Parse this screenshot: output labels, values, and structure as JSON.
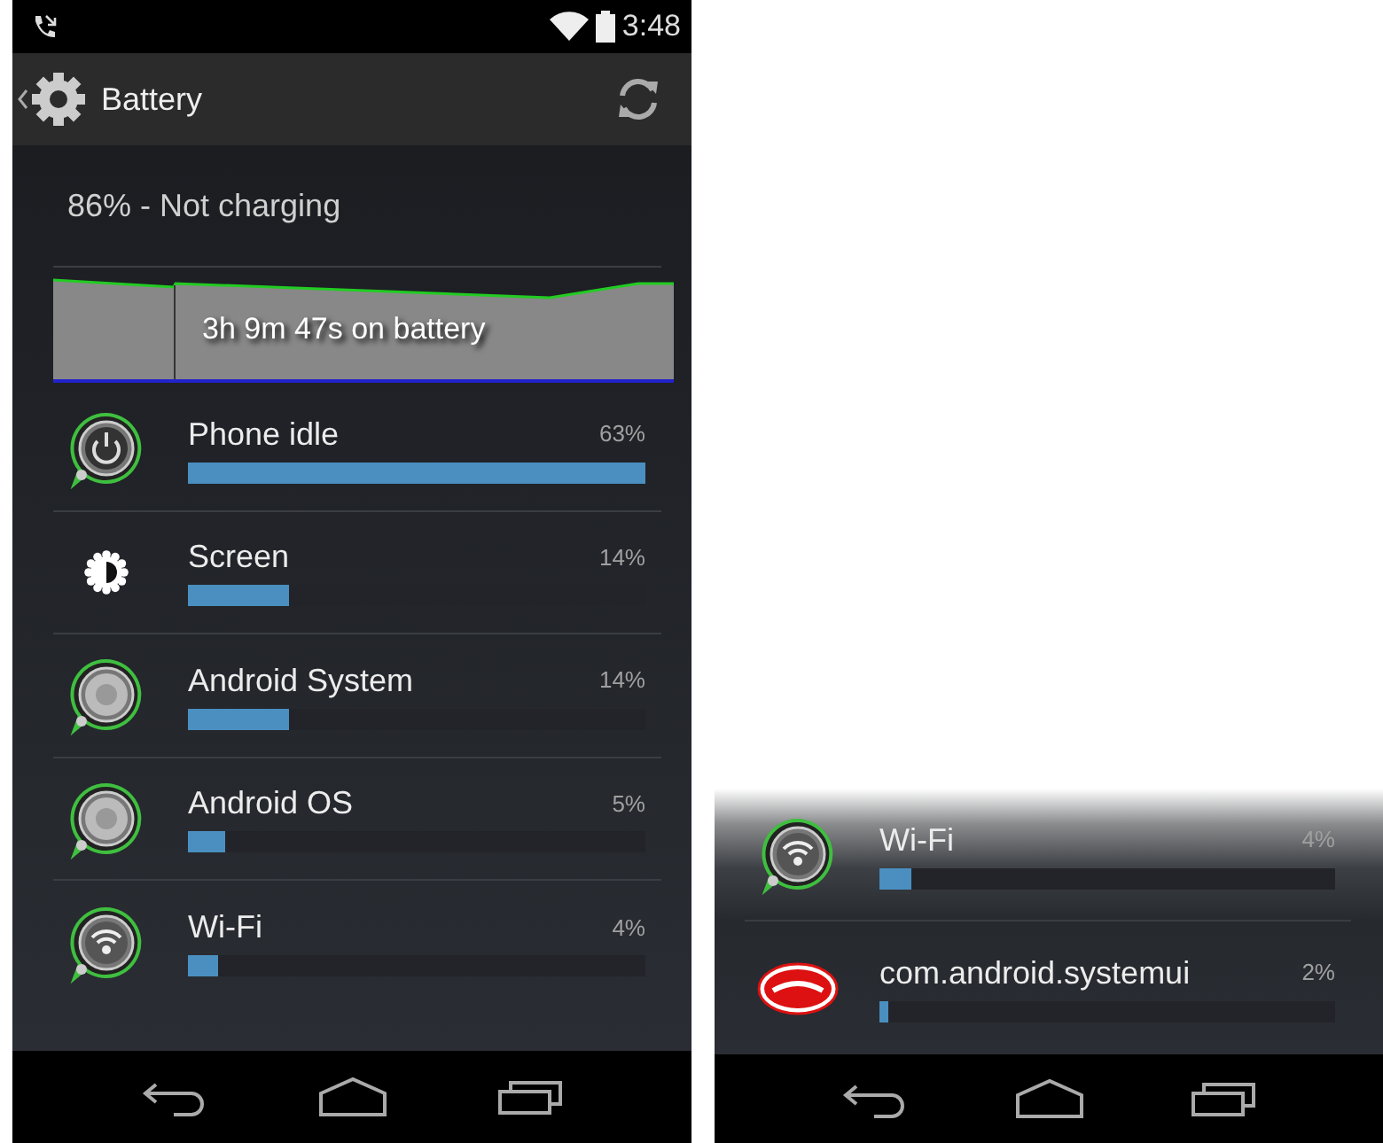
{
  "status_bar": {
    "time": "3:48"
  },
  "action_bar": {
    "title": "Battery"
  },
  "summary": "86% - Not charging",
  "history": {
    "label": "3h 9m 47s on battery"
  },
  "usage": [
    {
      "kind": "power",
      "name": "Phone idle",
      "percent": "63%",
      "level": 1.0
    },
    {
      "kind": "brightness",
      "name": "Screen",
      "percent": "14%",
      "level": 0.22
    },
    {
      "kind": "system",
      "name": "Android System",
      "percent": "14%",
      "level": 0.22
    },
    {
      "kind": "system",
      "name": "Android OS",
      "percent": "5%",
      "level": 0.08
    },
    {
      "kind": "wifi",
      "name": "Wi-Fi",
      "percent": "4%",
      "level": 0.066
    }
  ],
  "detail_view": {
    "usage": [
      {
        "kind": "wifi",
        "name": "Wi-Fi",
        "percent": "4%",
        "level": 0.07
      },
      {
        "kind": "android",
        "name": "com.android.systemui",
        "percent": "2%",
        "level": 0.02
      }
    ]
  }
}
